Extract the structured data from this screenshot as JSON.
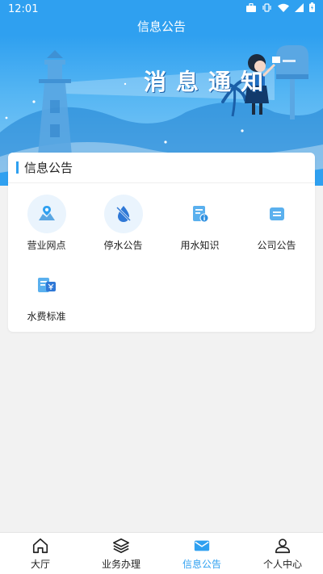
{
  "status": {
    "time": "12:01"
  },
  "header": {
    "title": "信息公告"
  },
  "banner": {
    "text": "消息通知"
  },
  "section": {
    "title": "信息公告"
  },
  "items": [
    {
      "label": "营业网点",
      "icon": "map-location-icon"
    },
    {
      "label": "停水公告",
      "icon": "no-water-drop-icon"
    },
    {
      "label": "用水知识",
      "icon": "document-info-icon"
    },
    {
      "label": "公司公告",
      "icon": "notice-list-icon"
    },
    {
      "label": "水费标准",
      "icon": "fee-yen-icon"
    }
  ],
  "tabs": [
    {
      "label": "大厅",
      "icon": "home-icon",
      "active": false
    },
    {
      "label": "业务办理",
      "icon": "layers-icon",
      "active": false
    },
    {
      "label": "信息公告",
      "icon": "mail-icon",
      "active": true
    },
    {
      "label": "个人中心",
      "icon": "user-icon",
      "active": false
    }
  ],
  "colors": {
    "primary": "#2fa0f0",
    "icon_bg": "#eaf4fd",
    "page_bg": "#f2f2f2"
  }
}
